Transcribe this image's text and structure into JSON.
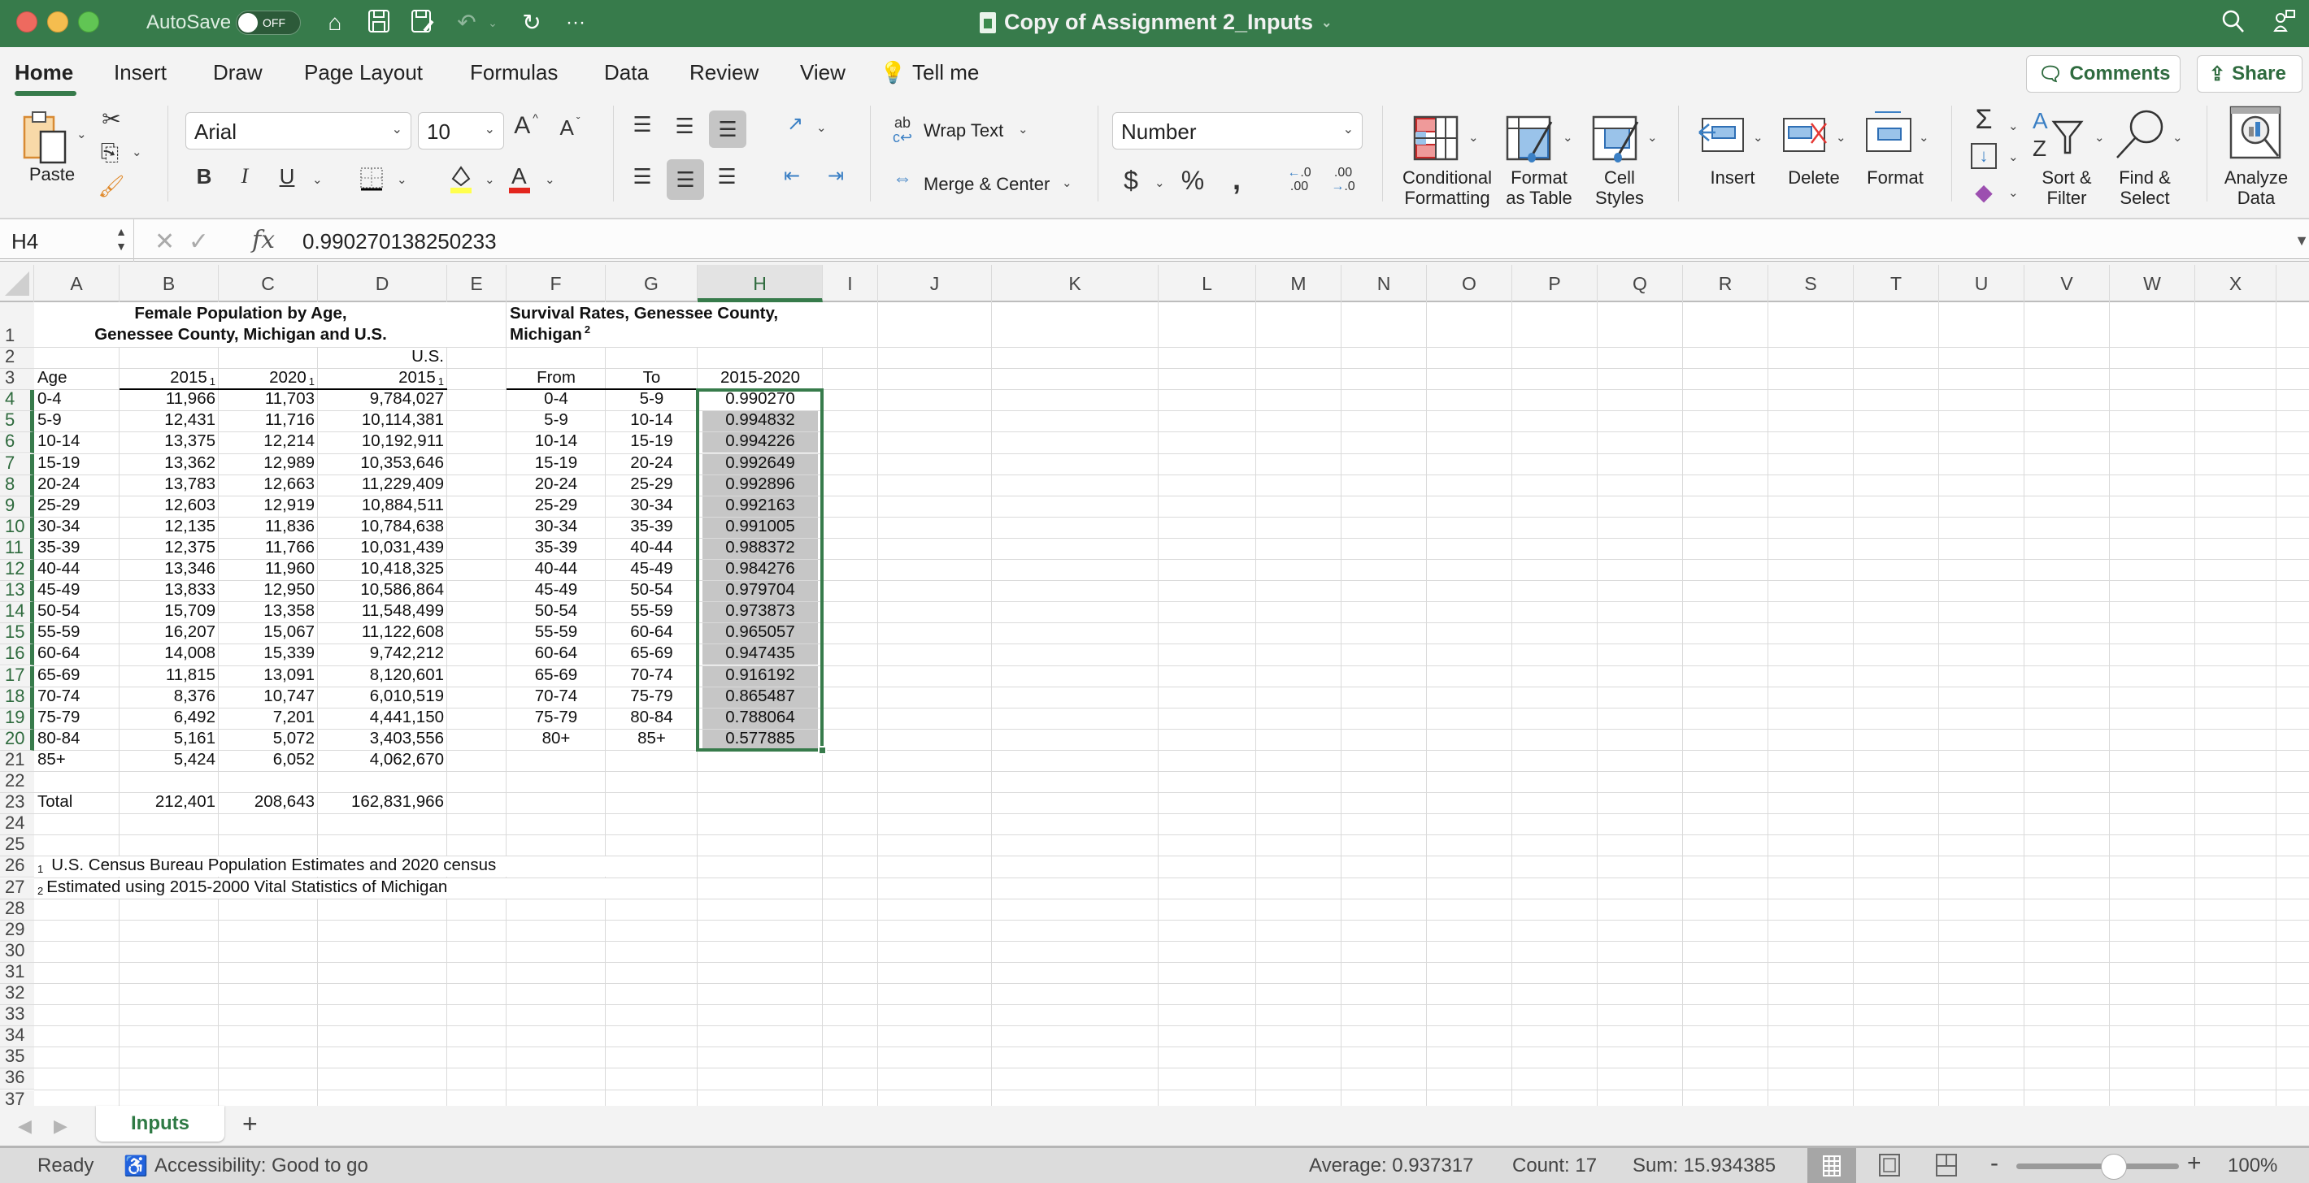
{
  "window": {
    "title": "Copy of Assignment 2_Inputs",
    "autosave_label": "AutoSave",
    "autosave_state": "OFF"
  },
  "ribbon_tabs": [
    "Home",
    "Insert",
    "Draw",
    "Page Layout",
    "Formulas",
    "Data",
    "Review",
    "View",
    "Tell me"
  ],
  "active_tab": "Home",
  "header_buttons": {
    "comments": "Comments",
    "share": "Share"
  },
  "ribbon": {
    "paste": "Paste",
    "font_name": "Arial",
    "font_size": "10",
    "wrap_text": "Wrap Text",
    "merge_center": "Merge & Center",
    "number_format": "Number",
    "conditional_formatting": [
      "Conditional",
      "Formatting"
    ],
    "format_as_table": [
      "Format",
      "as Table"
    ],
    "cell_styles": [
      "Cell",
      "Styles"
    ],
    "insert": "Insert",
    "delete": "Delete",
    "format": "Format",
    "sort_filter": [
      "Sort &",
      "Filter"
    ],
    "find_select": [
      "Find &",
      "Select"
    ],
    "analyze_data": [
      "Analyze",
      "Data"
    ],
    "colors": {
      "highlight": "#ffff4d",
      "font_color": "#e3261e",
      "accent": "#377b4b"
    }
  },
  "formula_bar": {
    "name_box": "H4",
    "formula": "0.990270138250233"
  },
  "columns": [
    "A",
    "B",
    "C",
    "D",
    "E",
    "F",
    "G",
    "H",
    "I",
    "J",
    "K",
    "L",
    "M",
    "N",
    "O",
    "P",
    "Q",
    "R",
    "S",
    "T",
    "U",
    "V",
    "W",
    "X"
  ],
  "selected_column": "H",
  "row_numbers": [
    "1",
    "2",
    "3",
    "4",
    "5",
    "6",
    "7",
    "8",
    "9",
    "10",
    "11",
    "12",
    "13",
    "14",
    "15",
    "16",
    "17",
    "18",
    "19",
    "20",
    "21",
    "22",
    "23",
    "24",
    "25",
    "26",
    "27",
    "28",
    "29",
    "30",
    "31",
    "32",
    "33",
    "34",
    "35",
    "36",
    "37"
  ],
  "sheet": {
    "title_left_line1": "Female Population by Age,",
    "title_left_line2": "Genessee County, Michigan and U.S.",
    "title_right_line1": "Survival Rates, Genessee County,",
    "title_right_line2": "Michigan",
    "title_right_sup": "2",
    "us_label": "U.S.",
    "headers": {
      "age": "Age",
      "b": "2015",
      "c": "2020",
      "d": "2015",
      "sup": "1",
      "from": "From",
      "to": "To",
      "period": "2015-2020"
    },
    "population_rows": [
      {
        "age": "0-4",
        "y2015": "11,966",
        "y2020": "11,703",
        "us2015": "9,784,027"
      },
      {
        "age": "5-9",
        "y2015": "12,431",
        "y2020": "11,716",
        "us2015": "10,114,381"
      },
      {
        "age": "10-14",
        "y2015": "13,375",
        "y2020": "12,214",
        "us2015": "10,192,911"
      },
      {
        "age": "15-19",
        "y2015": "13,362",
        "y2020": "12,989",
        "us2015": "10,353,646"
      },
      {
        "age": "20-24",
        "y2015": "13,783",
        "y2020": "12,663",
        "us2015": "11,229,409"
      },
      {
        "age": "25-29",
        "y2015": "12,603",
        "y2020": "12,919",
        "us2015": "10,884,511"
      },
      {
        "age": "30-34",
        "y2015": "12,135",
        "y2020": "11,836",
        "us2015": "10,784,638"
      },
      {
        "age": "35-39",
        "y2015": "12,375",
        "y2020": "11,766",
        "us2015": "10,031,439"
      },
      {
        "age": "40-44",
        "y2015": "13,346",
        "y2020": "11,960",
        "us2015": "10,418,325"
      },
      {
        "age": "45-49",
        "y2015": "13,833",
        "y2020": "12,950",
        "us2015": "10,586,864"
      },
      {
        "age": "50-54",
        "y2015": "15,709",
        "y2020": "13,358",
        "us2015": "11,548,499"
      },
      {
        "age": "55-59",
        "y2015": "16,207",
        "y2020": "15,067",
        "us2015": "11,122,608"
      },
      {
        "age": "60-64",
        "y2015": "14,008",
        "y2020": "15,339",
        "us2015": "9,742,212"
      },
      {
        "age": "65-69",
        "y2015": "11,815",
        "y2020": "13,091",
        "us2015": "8,120,601"
      },
      {
        "age": "70-74",
        "y2015": "8,376",
        "y2020": "10,747",
        "us2015": "6,010,519"
      },
      {
        "age": "75-79",
        "y2015": "6,492",
        "y2020": "7,201",
        "us2015": "4,441,150"
      },
      {
        "age": "80-84",
        "y2015": "5,161",
        "y2020": "5,072",
        "us2015": "3,403,556"
      },
      {
        "age": "85+",
        "y2015": "5,424",
        "y2020": "6,052",
        "us2015": "4,062,670"
      }
    ],
    "total": {
      "label": "Total",
      "y2015": "212,401",
      "y2020": "208,643",
      "us2015": "162,831,966"
    },
    "survival_rows": [
      {
        "from": "0-4",
        "to": "5-9",
        "rate": "0.990270"
      },
      {
        "from": "5-9",
        "to": "10-14",
        "rate": "0.994832"
      },
      {
        "from": "10-14",
        "to": "15-19",
        "rate": "0.994226"
      },
      {
        "from": "15-19",
        "to": "20-24",
        "rate": "0.992649"
      },
      {
        "from": "20-24",
        "to": "25-29",
        "rate": "0.992896"
      },
      {
        "from": "25-29",
        "to": "30-34",
        "rate": "0.992163"
      },
      {
        "from": "30-34",
        "to": "35-39",
        "rate": "0.991005"
      },
      {
        "from": "35-39",
        "to": "40-44",
        "rate": "0.988372"
      },
      {
        "from": "40-44",
        "to": "45-49",
        "rate": "0.984276"
      },
      {
        "from": "45-49",
        "to": "50-54",
        "rate": "0.979704"
      },
      {
        "from": "50-54",
        "to": "55-59",
        "rate": "0.973873"
      },
      {
        "from": "55-59",
        "to": "60-64",
        "rate": "0.965057"
      },
      {
        "from": "60-64",
        "to": "65-69",
        "rate": "0.947435"
      },
      {
        "from": "65-69",
        "to": "70-74",
        "rate": "0.916192"
      },
      {
        "from": "70-74",
        "to": "75-79",
        "rate": "0.865487"
      },
      {
        "from": "75-79",
        "to": "80-84",
        "rate": "0.788064"
      },
      {
        "from": "80+",
        "to": "85+",
        "rate": "0.577885"
      }
    ],
    "footnote1_sup": "1",
    "footnote1": "U.S. Census Bureau Population Estimates and 2020 census",
    "footnote2_sup": "2",
    "footnote2": "Estimated using 2015-2000 Vital Statistics of Michigan"
  },
  "sheet_tabs": [
    "Inputs"
  ],
  "status_bar": {
    "ready": "Ready",
    "accessibility": "Accessibility: Good to go",
    "average": "Average: 0.937317",
    "count": "Count: 17",
    "sum": "Sum: 15.934385",
    "zoom": "100%",
    "zoom_percent": 100
  }
}
